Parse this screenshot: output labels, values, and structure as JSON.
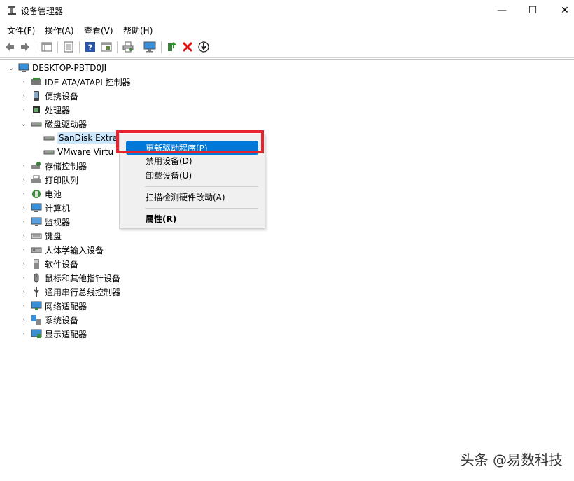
{
  "window": {
    "title": "设备管理器",
    "controls": {
      "minimize": "—",
      "maximize": "☐",
      "close": "✕"
    }
  },
  "menu": [
    "文件(F)",
    "操作(A)",
    "查看(V)",
    "帮助(H)"
  ],
  "tree": {
    "root": "DESKTOP-PBTD0JI",
    "categories": [
      {
        "label": "IDE ATA/ATAPI 控制器",
        "icon": "ide-controller-icon",
        "expanded": false
      },
      {
        "label": "便携设备",
        "icon": "portable-device-icon",
        "expanded": false
      },
      {
        "label": "处理器",
        "icon": "processor-icon",
        "expanded": false
      },
      {
        "label": "磁盘驱动器",
        "icon": "disk-drive-icon",
        "expanded": true,
        "children": [
          "SanDisk Extre",
          "VMware Virtu"
        ]
      },
      {
        "label": "存储控制器",
        "icon": "storage-controller-icon",
        "expanded": false
      },
      {
        "label": "打印队列",
        "icon": "printer-icon",
        "expanded": false
      },
      {
        "label": "电池",
        "icon": "battery-icon",
        "expanded": false
      },
      {
        "label": "计算机",
        "icon": "computer-icon",
        "expanded": false
      },
      {
        "label": "监视器",
        "icon": "monitor-icon",
        "expanded": false
      },
      {
        "label": "键盘",
        "icon": "keyboard-icon",
        "expanded": false
      },
      {
        "label": "人体学输入设备",
        "icon": "hid-icon",
        "expanded": false
      },
      {
        "label": "软件设备",
        "icon": "software-device-icon",
        "expanded": false
      },
      {
        "label": "鼠标和其他指针设备",
        "icon": "mouse-icon",
        "expanded": false
      },
      {
        "label": "通用串行总线控制器",
        "icon": "usb-icon",
        "expanded": false
      },
      {
        "label": "网络适配器",
        "icon": "network-adapter-icon",
        "expanded": false
      },
      {
        "label": "系统设备",
        "icon": "system-device-icon",
        "expanded": false
      },
      {
        "label": "显示适配器",
        "icon": "display-adapter-icon",
        "expanded": false
      }
    ]
  },
  "context_menu": {
    "items": [
      "更新驱动程序(P)",
      "禁用设备(D)",
      "卸载设备(U)",
      "扫描检测硬件改动(A)",
      "属性(R)"
    ],
    "highlighted": "更新驱动程序(P)"
  },
  "watermark": "头条 @易数科技",
  "colors": {
    "highlight": "#0078d7",
    "annotation_box": "#e8232f",
    "selection": "#cce8ff"
  }
}
